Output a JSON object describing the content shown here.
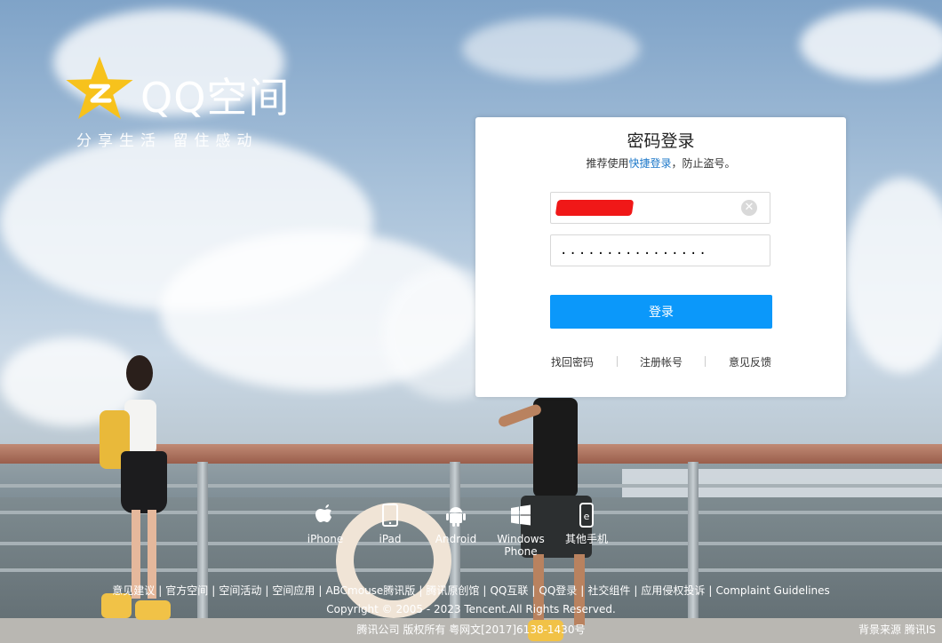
{
  "brand": {
    "logo_text": "QQ空间",
    "slogan": "分享生活  留住感动",
    "star_color": "#f7c21c"
  },
  "login": {
    "title": "密码登录",
    "tip_before": "推荐使用",
    "tip_link": "快捷登录",
    "tip_after": "，防止盗号。",
    "username_value": "",
    "password_value": "................",
    "clear_glyph": "✕",
    "submit_label": "登录",
    "accent": "#0b98fa",
    "links": [
      "找回密码",
      "注册帐号",
      "意见反馈"
    ]
  },
  "platforms": [
    {
      "icon": "apple-icon",
      "label": "iPhone"
    },
    {
      "icon": "ipad-icon",
      "label": "iPad"
    },
    {
      "icon": "android-icon",
      "label": "Android"
    },
    {
      "icon": "windows-icon",
      "label": "Windows Phone"
    },
    {
      "icon": "phone-icon",
      "label": "其他手机"
    }
  ],
  "footer": {
    "links": [
      "意见建议",
      "官方空间",
      "空间活动",
      "空间应用",
      "ABCmouse腾讯版",
      "腾讯原创馆",
      "QQ互联",
      "QQ登录",
      "社交组件",
      "应用侵权投诉",
      "Complaint Guidelines"
    ],
    "copyright": "Copyright © 2005 - 2023 Tencent.All Rights Reserved.",
    "license": "腾讯公司 版权所有 粤网文[2017]6138-1430号",
    "bg_source": "背景来源  腾讯IS"
  }
}
